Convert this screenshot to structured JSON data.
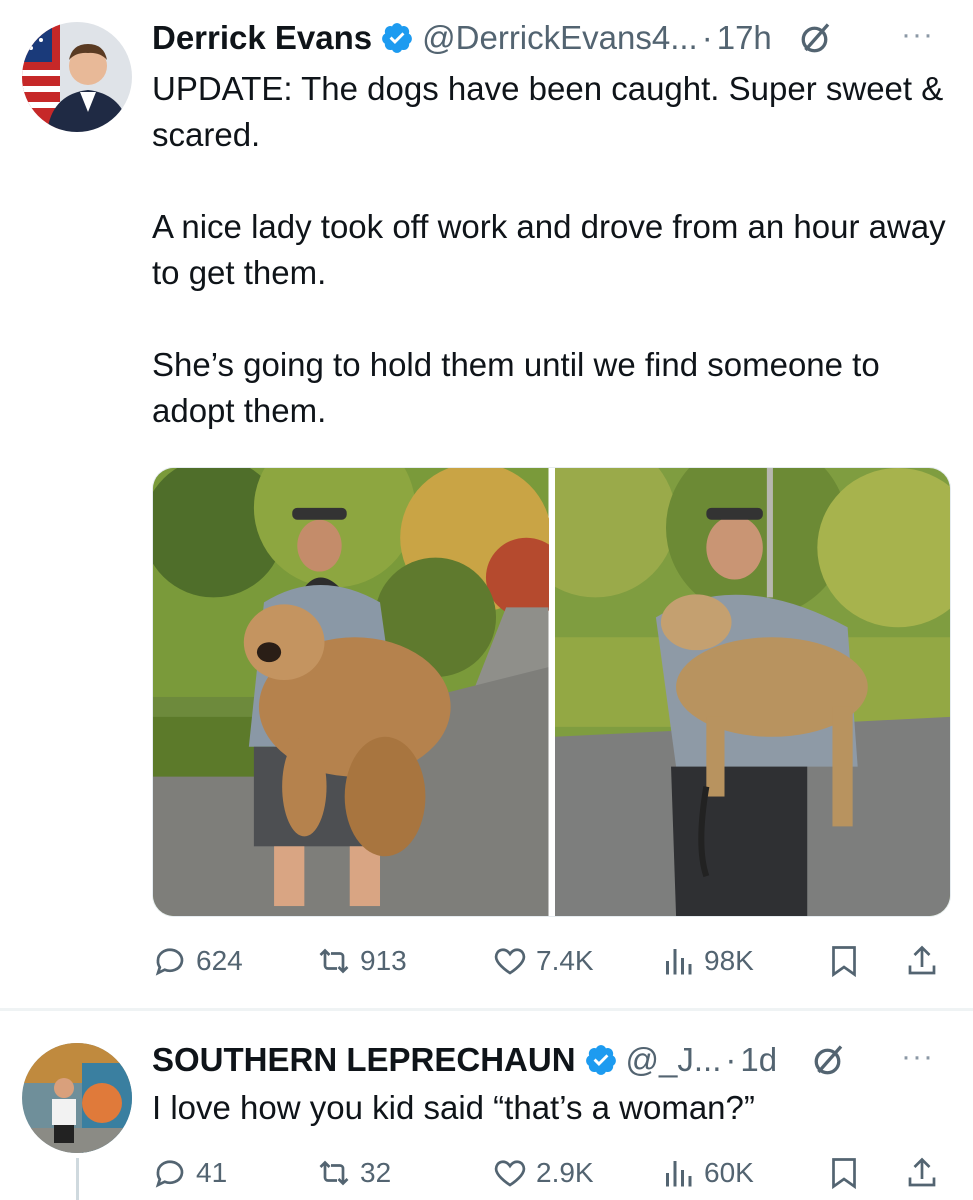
{
  "tweets": [
    {
      "author": {
        "display_name": "Derrick Evans",
        "handle": "@DerrickEvans4...",
        "verified": true
      },
      "dot": "·",
      "time": "17h",
      "more": "···",
      "text": "UPDATE: The dogs have been caught. Super sweet & scared.\n\nA nice lady took off work and drove from an hour away to get them.\n\nShe’s going to hold them until we find someone to adopt them.",
      "media": [
        "photo-man-holding-shaggy-dog-on-road",
        "photo-man-holding-dog-wooded-road"
      ],
      "actions": {
        "replies": "624",
        "reposts": "913",
        "likes": "7.4K",
        "views": "98K"
      }
    },
    {
      "author": {
        "display_name": "SOUTHERN LEPRECHAUN",
        "handle": "@_J...",
        "verified": true
      },
      "dot": "·",
      "time": "1d",
      "more": "···",
      "text": "I love how you kid said “that’s a woman?”",
      "actions": {
        "replies": "41",
        "reposts": "32",
        "likes": "2.9K",
        "views": "60K"
      }
    }
  ],
  "icons": {
    "reply": "reply-icon",
    "repost": "repost-icon",
    "like": "heart-icon",
    "views": "views-icon",
    "bookmark": "bookmark-icon",
    "share": "share-icon",
    "verified": "verified-badge-icon",
    "grok": "grok-icon"
  },
  "colors": {
    "text": "#0f1419",
    "secondary": "#536471",
    "verified": "#1d9bf0",
    "separator": "#eff3f4"
  }
}
